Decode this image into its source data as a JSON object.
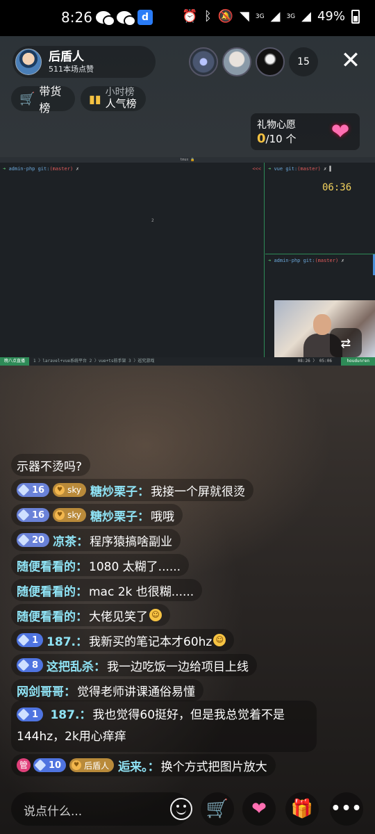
{
  "status_bar": {
    "time": "8:26",
    "network_1": "3G",
    "network_2": "3G",
    "battery": "49%"
  },
  "host": {
    "name": "后盾人",
    "likes": "511本场点赞"
  },
  "viewers": {
    "count": "15"
  },
  "chips": {
    "goods_rank": "带货榜",
    "hour_rank": "小时榜",
    "popularity_rank": "人气榜"
  },
  "wish": {
    "title": "礼物心愿",
    "current": "0",
    "total": "/10 个"
  },
  "stream": {
    "tmux_title": "tmux 🔒",
    "left_pane_prompt": {
      "dir": "admin-php",
      "git": "git:",
      "branch": "(master)",
      "mark": "✗",
      "tail": "<<<"
    },
    "left_pane_content": "2",
    "right_top_prompt": {
      "dir": "vue",
      "git": "git:",
      "branch": "(master)",
      "mark": "✗"
    },
    "clock": "06:36",
    "right_bottom_prompt": {
      "dir": "admin-php",
      "git": "git:",
      "branch": "(master)",
      "mark": "✗"
    },
    "status_bar": {
      "session": "晚八点直播",
      "windows": "1 〉laravel+vue系统平台    2 〉vue+ts前手架    3 〉巡究游戏",
      "clock": "08:26 〉 05:06",
      "host": "houdunren"
    }
  },
  "chat": [
    {
      "user": "",
      "text": "示器不烫吗?"
    },
    {
      "level": "16",
      "fan": "sky",
      "user": "糖炒栗子：",
      "text": "我接一个屏就很烫"
    },
    {
      "level": "16",
      "fan": "sky",
      "user": "糖炒栗子：",
      "text": "哦哦"
    },
    {
      "level": "20",
      "user": "凉茶：",
      "text": "程序猿搞啥副业"
    },
    {
      "user": "随便看看的：",
      "text": "1080 太糊了......"
    },
    {
      "user": "随便看看的：",
      "text": "mac 2k 也很糊......"
    },
    {
      "user": "随便看看的：",
      "text": "大佬见笑了"
    },
    {
      "level": "1",
      "user": "187.：",
      "text": "我新买的笔记本才60hz"
    },
    {
      "level": "8",
      "user": "这把乱杀：",
      "text": "我一边吃饭一边给项目上线"
    },
    {
      "user": "网剑哥哥：",
      "text": "觉得老师讲课通俗易懂"
    },
    {
      "level": "1",
      "user": "187.：",
      "text": "我也觉得60挺好，但是我总觉着不是144hz，2k用心痒痒"
    },
    {
      "mgr": "管",
      "level": "10",
      "fan": "后盾人",
      "user": "逅来。：",
      "text": "换个方式把图片放大"
    }
  ],
  "bottom_bar": {
    "input_placeholder": "说点什么...",
    "icons": [
      "emoji-icon",
      "cart-icon",
      "heart-icon",
      "gift-icon",
      "more-icon"
    ]
  },
  "colors": {
    "username": "#8fe3f5",
    "accent_gold": "#f5c242",
    "level_badge": "#6a82d8"
  }
}
